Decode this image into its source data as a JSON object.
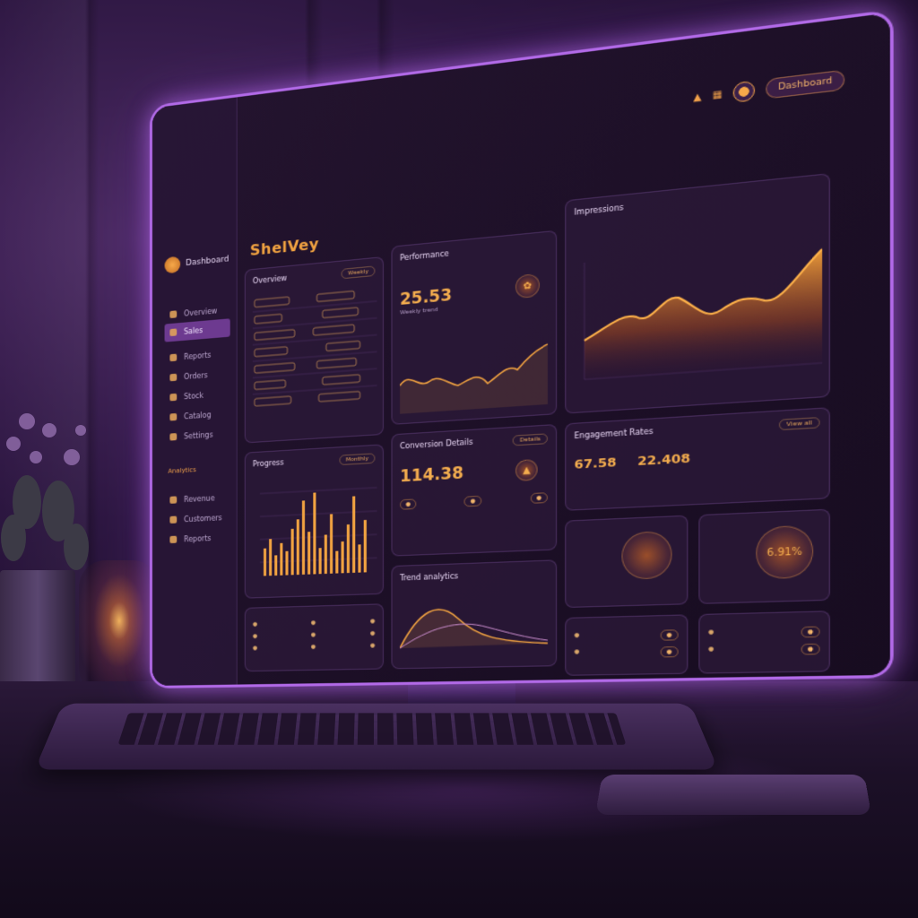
{
  "app": {
    "title": "ShelVey",
    "brand": "Dashboard"
  },
  "header": {
    "button_label": "Dashboard"
  },
  "sidebar": {
    "items": [
      {
        "label": "Overview"
      },
      {
        "label": "Sales"
      },
      {
        "label": "Reports"
      },
      {
        "label": "Orders"
      },
      {
        "label": "Stock"
      },
      {
        "label": "Catalog"
      },
      {
        "label": "Settings"
      }
    ],
    "section_heading": "Analytics",
    "section_items": [
      {
        "label": "Revenue"
      },
      {
        "label": "Customers"
      },
      {
        "label": "Reports"
      }
    ]
  },
  "cards": {
    "overview": {
      "title": "Overview",
      "chip": "Weekly"
    },
    "performance": {
      "title": "Performance",
      "value": "25.53",
      "caption": "Weekly trend"
    },
    "main_chart": {
      "title": "Impressions"
    },
    "bars": {
      "title": "Progress",
      "chip": "Monthly"
    },
    "conversions": {
      "title": "Conversion Details",
      "value": "114.38",
      "chip": "Details"
    },
    "engagement": {
      "title": "Engagement Rates",
      "chip": "View all"
    },
    "stat_a": {
      "value": "67.58"
    },
    "stat_b": {
      "value": "22.408"
    },
    "ring_b": {
      "value": "6.91%"
    },
    "trend": {
      "title": "Trend analytics"
    }
  },
  "colors": {
    "accent": "#f2a341",
    "frame": "#b26ae8",
    "panel": "#2c1a3a"
  },
  "icons": {
    "logo": "logo-icon",
    "bell": "bell-icon",
    "settings": "settings-icon"
  }
}
